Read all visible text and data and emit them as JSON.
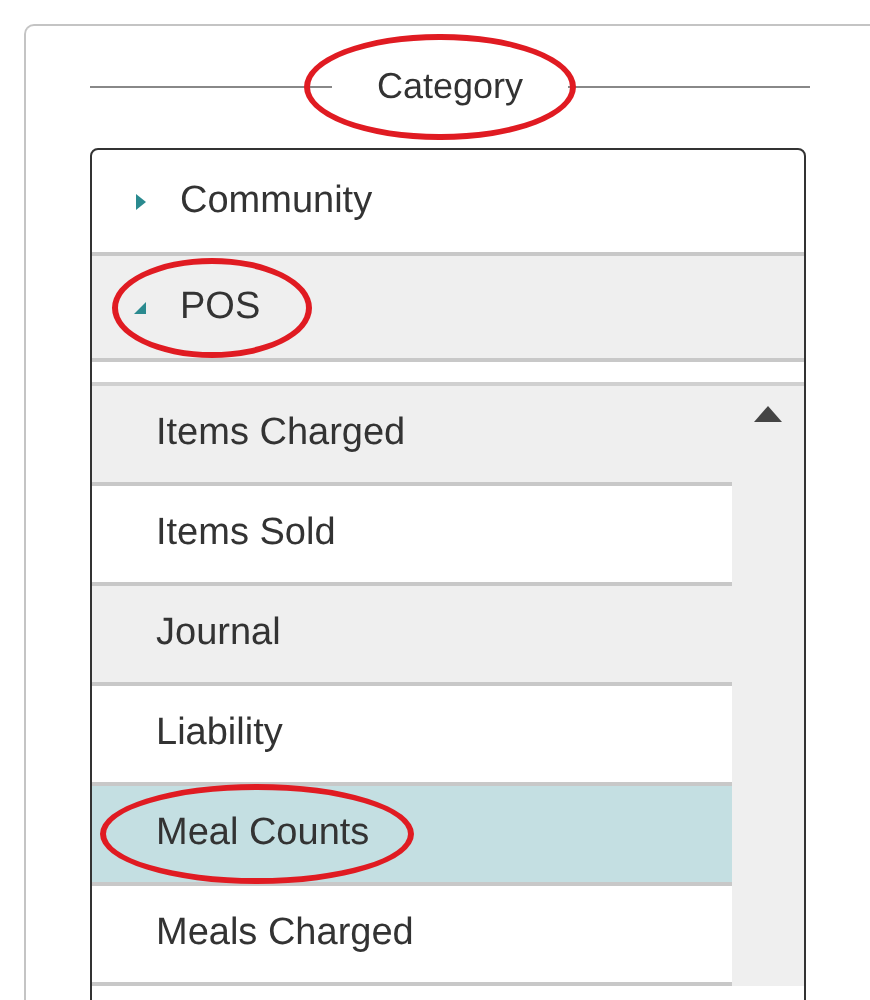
{
  "fieldset": {
    "legend": "Category",
    "legend_circled": true
  },
  "groups": [
    {
      "label": "Community",
      "expanded": false,
      "circled": false
    },
    {
      "label": "POS",
      "expanded": true,
      "circled": true,
      "children": [
        {
          "label": "Items Charged",
          "selected": false,
          "circled": false
        },
        {
          "label": "Items Sold",
          "selected": false,
          "circled": false
        },
        {
          "label": "Journal",
          "selected": false,
          "circled": false
        },
        {
          "label": "Liability",
          "selected": false,
          "circled": false
        },
        {
          "label": "Meal Counts",
          "selected": true,
          "circled": true
        },
        {
          "label": "Meals Charged",
          "selected": false,
          "circled": false
        }
      ]
    }
  ]
}
